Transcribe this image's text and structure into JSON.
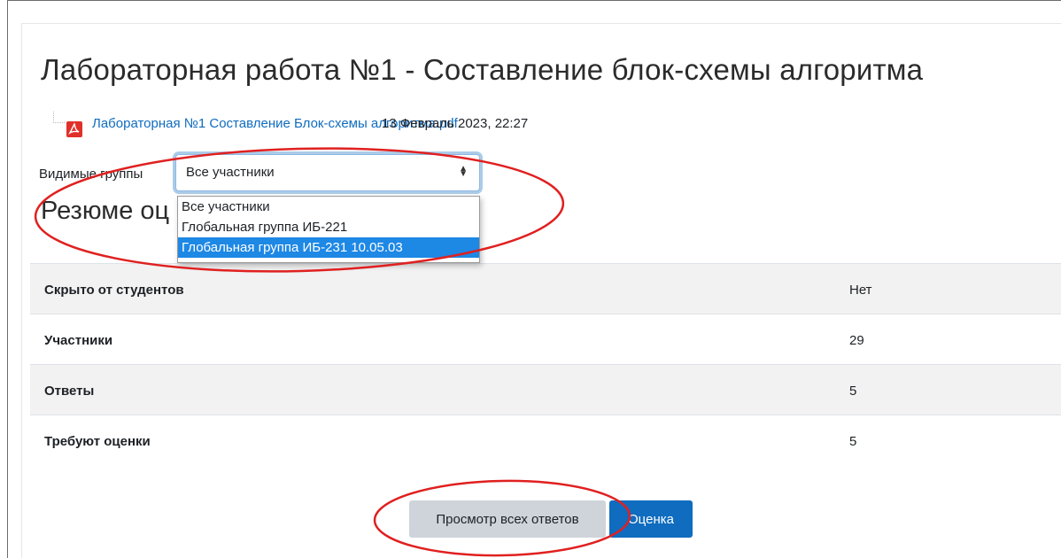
{
  "page": {
    "title": "Лабораторная работа №1 - Составление блок-схемы алгоритма"
  },
  "attachment": {
    "icon": "pdf-icon",
    "file_name": "Лабораторная №1 Составление Блок-схемы алгоритма.pdf",
    "date": "13 Февраль 2023, 22:27"
  },
  "groups": {
    "label": "Видимые группы",
    "selected": "Все участники",
    "options": [
      "Все участники",
      "Глобальная группа ИБ-221",
      "Глобальная группа ИБ-231 10.05.03"
    ],
    "highlighted_option": "Глобальная группа ИБ-231 10.05.03"
  },
  "summary": {
    "heading": "Резюме оц",
    "rows": [
      {
        "label": "Скрыто от студентов",
        "value": "Нет"
      },
      {
        "label": "Участники",
        "value": "29"
      },
      {
        "label": "Ответы",
        "value": "5"
      },
      {
        "label": "Требуют оценки",
        "value": "5"
      }
    ]
  },
  "buttons": {
    "view_all": "Просмотр всех ответов",
    "grade": "Оценка"
  },
  "colors": {
    "link": "#0f6cbf",
    "primary_button": "#0f6cbf",
    "secondary_button": "#ced4da",
    "highlight": "#1e88e5",
    "annotation": "#e02020"
  }
}
